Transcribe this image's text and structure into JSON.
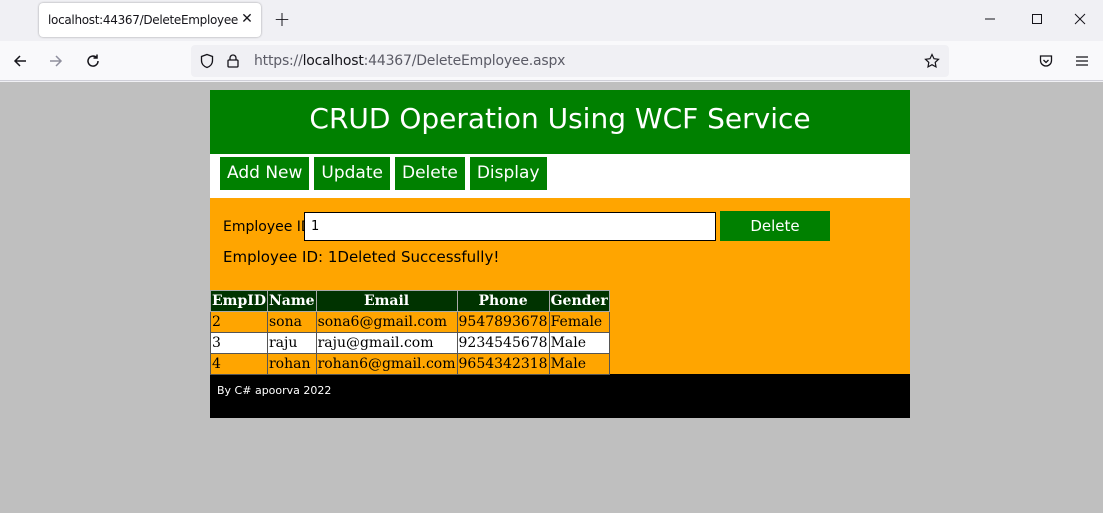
{
  "browser": {
    "tab_title": "localhost:44367/DeleteEmployee.aspx",
    "url_prefix": "https://",
    "url_host": "localhost",
    "url_rest": ":44367/DeleteEmployee.aspx"
  },
  "page": {
    "title": "CRUD Operation Using WCF Service",
    "menu": [
      "Add New",
      "Update",
      "Delete",
      "Display"
    ],
    "form": {
      "label": "Employee ID",
      "input_value": "1",
      "button": "Delete",
      "message": "Employee ID: 1Deleted Successfully!"
    },
    "table": {
      "headers": [
        "EmpID",
        "Name",
        "Email",
        "Phone",
        "Gender"
      ],
      "rows": [
        [
          "2",
          "sona",
          "sona6@gmail.com",
          "9547893678",
          "Female"
        ],
        [
          "3",
          "raju",
          "raju@gmail.com",
          "9234545678",
          "Male"
        ],
        [
          "4",
          "rohan",
          "rohan6@gmail.com",
          "9654342318",
          "Male"
        ]
      ]
    },
    "footer": "By C# apoorva 2022"
  },
  "colors": {
    "header_bg": "#008000",
    "content_bg": "#ffa500",
    "table_header_bg": "#003300",
    "footer_bg": "#000000",
    "page_bg": "#bfbfbf"
  },
  "icons": [
    "back-arrow-icon",
    "forward-arrow-icon",
    "reload-icon",
    "shield-icon",
    "lock-icon",
    "star-icon",
    "pocket-icon",
    "menu-icon",
    "minimize-icon",
    "maximize-icon",
    "close-icon",
    "plus-icon"
  ]
}
